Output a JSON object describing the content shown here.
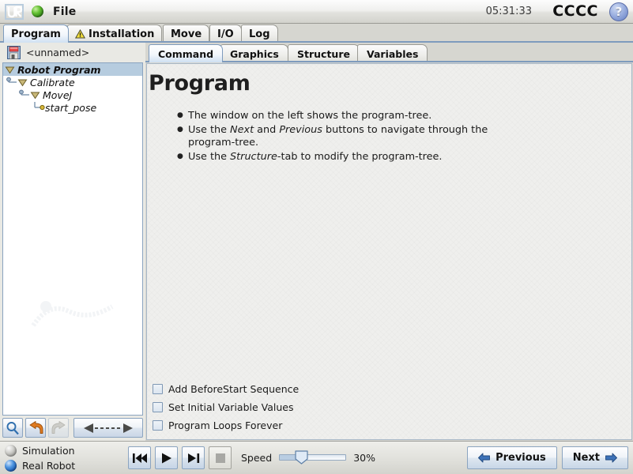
{
  "titlebar": {
    "logo_icon": "ur-logo-icon",
    "status_orb_icon": "green-status-orb-icon",
    "file_menu": "File",
    "clock": "05:31:33",
    "robot_name": "CCCC",
    "help_icon": "help-question-icon",
    "help_glyph": "?"
  },
  "main_tabs": [
    {
      "label": "Program",
      "selected": true,
      "icon": null
    },
    {
      "label": "Installation",
      "selected": false,
      "icon": "warning-triangle-icon"
    },
    {
      "label": "Move",
      "selected": false,
      "icon": null
    },
    {
      "label": "I/O",
      "selected": false,
      "icon": null
    },
    {
      "label": "Log",
      "selected": false,
      "icon": null
    }
  ],
  "left_panel": {
    "save_icon": "floppy-save-icon",
    "file_name": "<unnamed>",
    "tree": [
      {
        "label": "Robot Program",
        "depth": 0,
        "selected": true,
        "node": "expand-triangle-icon"
      },
      {
        "label": "Calibrate",
        "depth": 1,
        "selected": false,
        "node": "expand-triangle-icon"
      },
      {
        "label": "MoveJ",
        "depth": 2,
        "selected": false,
        "node": "expand-triangle-icon"
      },
      {
        "label": "start_pose",
        "depth": 3,
        "selected": false,
        "node": "waypoint-dot-icon"
      }
    ],
    "toolbar": {
      "search_icon": "search-magnifier-icon",
      "undo_icon": "undo-arrow-icon",
      "redo_icon": "redo-arrow-icon",
      "redo_disabled": true,
      "move_icon": "move-left-right-icon"
    }
  },
  "sub_tabs": [
    {
      "label": "Command",
      "selected": true
    },
    {
      "label": "Graphics",
      "selected": false
    },
    {
      "label": "Structure",
      "selected": false
    },
    {
      "label": "Variables",
      "selected": false
    }
  ],
  "content": {
    "title": "Program",
    "bullets": [
      {
        "pre": "The window on the left shows the program-tree.",
        "em": "",
        "post": ""
      },
      {
        "pre": "Use the ",
        "em": "Next",
        "mid": " and ",
        "em2": "Previous",
        "post": " buttons to navigate through the program-tree."
      },
      {
        "pre": "Use the ",
        "em": "Structure",
        "post": "-tab to modify the program-tree."
      }
    ],
    "checkboxes": [
      {
        "label": "Add BeforeStart Sequence",
        "checked": false
      },
      {
        "label": "Set Initial Variable Values",
        "checked": false
      },
      {
        "label": "Program Loops Forever",
        "checked": false
      }
    ]
  },
  "bottom_bar": {
    "run_modes": [
      {
        "label": "Simulation",
        "selected": false,
        "icon": "status-orb-off-icon"
      },
      {
        "label": "Real Robot",
        "selected": true,
        "icon": "status-orb-on-icon"
      }
    ],
    "transport": [
      {
        "name": "rewind",
        "icon": "rewind-to-start-icon"
      },
      {
        "name": "play",
        "icon": "play-icon"
      },
      {
        "name": "step",
        "icon": "step-forward-icon"
      },
      {
        "name": "stop",
        "icon": "stop-icon"
      }
    ],
    "speed_label": "Speed",
    "speed_value": "30%",
    "speed_percent": 30,
    "previous_label": "Previous",
    "previous_icon": "arrow-left-icon",
    "next_label": "Next",
    "next_icon": "arrow-right-icon"
  },
  "colors": {
    "accent_blue": "#7e9bbd",
    "selection_blue": "#b6ccdf",
    "tab_border": "#9a9a94",
    "window_bg": "#d6d6d0",
    "content_bg": "#efefed",
    "warning_yellow": "#f5e03c",
    "undo_orange": "#e07b20",
    "nav_arrow_blue": "#3d72b8"
  }
}
